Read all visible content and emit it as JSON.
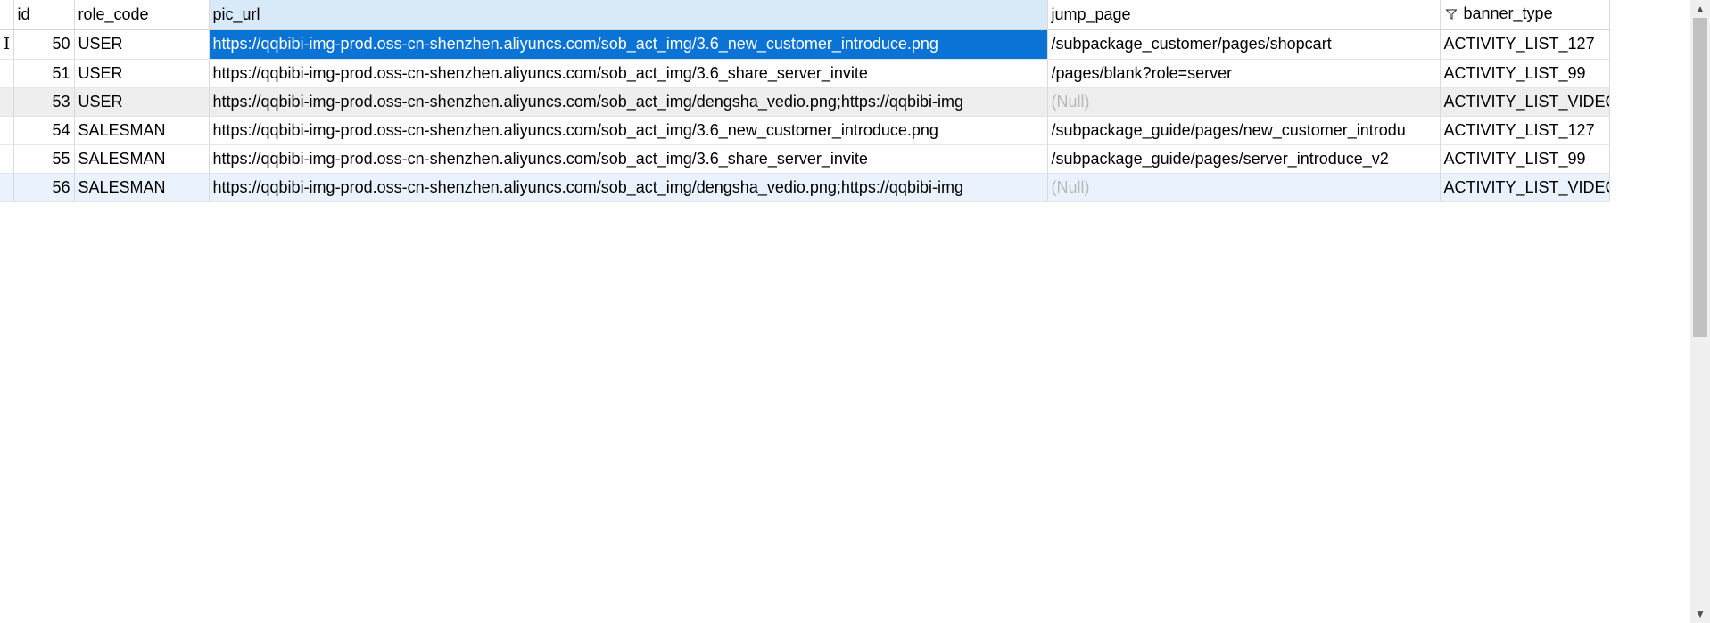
{
  "columns": {
    "id": "id",
    "role_code": "role_code",
    "pic_url": "pic_url",
    "jump_page": "jump_page",
    "banner_type": "banner_type"
  },
  "rows": [
    {
      "id": "50",
      "role_code": "USER",
      "pic_url": "https://qqbibi-img-prod.oss-cn-shenzhen.aliyuncs.com/sob_act_img/3.6_new_customer_introduce.png",
      "jump_page": "/subpackage_customer/pages/shopcart",
      "banner_type": "ACTIVITY_LIST_127"
    },
    {
      "id": "51",
      "role_code": "USER",
      "pic_url": "https://qqbibi-img-prod.oss-cn-shenzhen.aliyuncs.com/sob_act_img/3.6_share_server_invite",
      "jump_page": "/pages/blank?role=server",
      "banner_type": "ACTIVITY_LIST_99"
    },
    {
      "id": "53",
      "role_code": "USER",
      "pic_url": "https://qqbibi-img-prod.oss-cn-shenzhen.aliyuncs.com/sob_act_img/dengsha_vedio.png;https://qqbibi-img",
      "jump_page": "(Null)",
      "banner_type": "ACTIVITY_LIST_VIDEC"
    },
    {
      "id": "54",
      "role_code": "SALESMAN",
      "pic_url": "https://qqbibi-img-prod.oss-cn-shenzhen.aliyuncs.com/sob_act_img/3.6_new_customer_introduce.png",
      "jump_page": "/subpackage_guide/pages/new_customer_introdu",
      "banner_type": "ACTIVITY_LIST_127"
    },
    {
      "id": "55",
      "role_code": "SALESMAN",
      "pic_url": "https://qqbibi-img-prod.oss-cn-shenzhen.aliyuncs.com/sob_act_img/3.6_share_server_invite",
      "jump_page": "/subpackage_guide/pages/server_introduce_v2",
      "banner_type": "ACTIVITY_LIST_99"
    },
    {
      "id": "56",
      "role_code": "SALESMAN",
      "pic_url": "https://qqbibi-img-prod.oss-cn-shenzhen.aliyuncs.com/sob_act_img/dengsha_vedio.png;https://qqbibi-img",
      "jump_page": "(Null)",
      "banner_type": "ACTIVITY_LIST_VIDEC"
    }
  ],
  "icons": {
    "row_cursor": "text-cursor-icon",
    "filter": "filter-icon",
    "scroll_up": "chevron-up-icon",
    "scroll_down": "chevron-down-icon"
  },
  "colors": {
    "selected_cell": "#0a74d6",
    "active_header": "#d8e9f8",
    "null_text": "#b8b8b8",
    "striped_row": "#eeeeee",
    "current_row": "#eaf3fd"
  }
}
